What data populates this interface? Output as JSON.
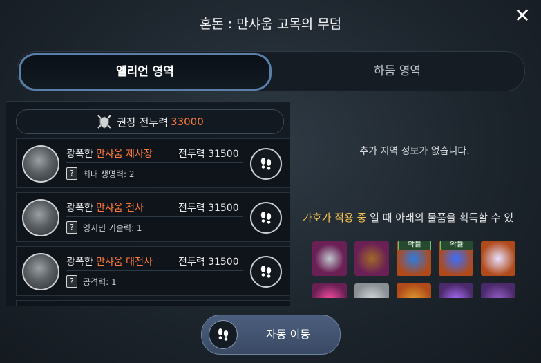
{
  "title": "혼돈 : 만샤움 고목의 무덤",
  "tabs": [
    {
      "label": "엘리언 영역",
      "active": true
    },
    {
      "label": "하둠 영역",
      "active": false
    }
  ],
  "recommended": {
    "label": "권장 전투력",
    "value": "33000"
  },
  "bosses": [
    {
      "prefix": "광폭한 ",
      "name": "만샤움 제사장",
      "power": "전투력 31500",
      "stat": "최대 생명력: 2"
    },
    {
      "prefix": "광폭한 ",
      "name": "만샤움 전사",
      "power": "전투력 31500",
      "stat": "영지민 기술력: 1"
    },
    {
      "prefix": "광폭한 ",
      "name": "만샤움 대전사",
      "power": "전투력 31500",
      "stat": "공격력: 1"
    }
  ],
  "info_text": "추가 지역 정보가 없습니다.",
  "blessing": {
    "highlight": "가호가 적용 중",
    "rest": " 일 때 아래의 물품을 획득할 수 있"
  },
  "items": [
    {
      "icon": "ring-icon",
      "bg": "#6a1f55"
    },
    {
      "icon": "book-icon",
      "bg": "#6a1f55"
    },
    {
      "icon": "blue-crystal-icon",
      "bg": "#b04a1a",
      "badge": "확률"
    },
    {
      "icon": "blue-orb-icon",
      "bg": "#b04a1a",
      "badge": "확률"
    },
    {
      "icon": "gem-brooch-icon",
      "bg": "#b04a1a"
    },
    {
      "icon": "pink-item-icon",
      "bg": "#6a1f55"
    },
    {
      "icon": "scroll-icon",
      "bg": "#8a8f94"
    },
    {
      "icon": "gold-item-icon",
      "bg": "#b04a1a"
    },
    {
      "icon": "purple-item-icon",
      "bg": "#4a2a6a"
    },
    {
      "icon": "dark-item-icon",
      "bg": "#4a2a6a"
    }
  ],
  "auto_move": {
    "label": "자동 이동"
  },
  "qmark": "?",
  "close_glyph": "✕"
}
